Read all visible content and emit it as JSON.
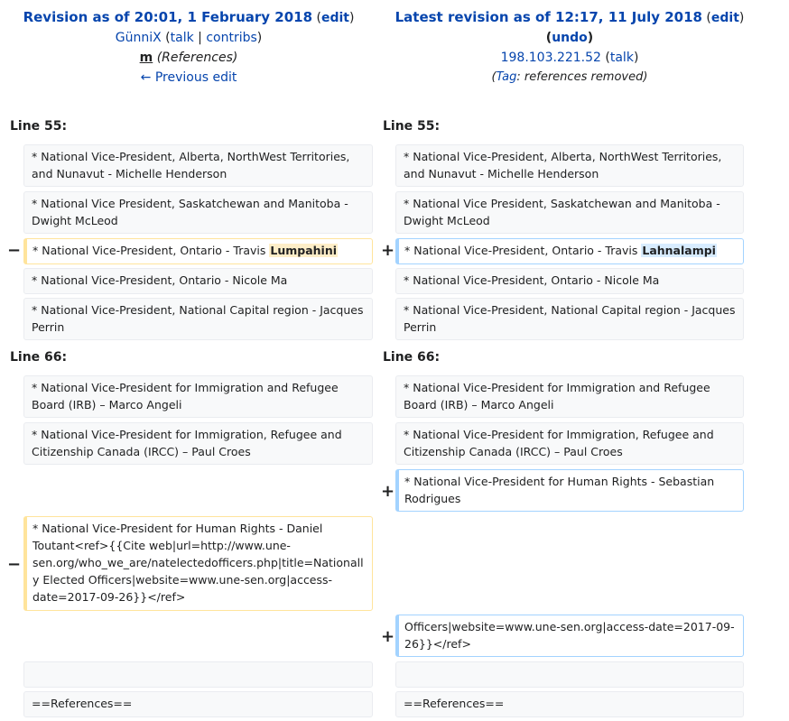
{
  "left_header": {
    "title": "Revision as of 20:01, 1 February 2018",
    "edit": "edit",
    "user": "GünniX",
    "talk": "talk",
    "contribs": "contribs",
    "minor": "m",
    "summary": "(References)",
    "previous": "← Previous edit"
  },
  "right_header": {
    "title": "Latest revision as of 12:17, 11 July 2018",
    "edit": "edit",
    "undo": "undo",
    "user": "198.103.221.52",
    "talk": "talk",
    "tag_label": "Tag",
    "tag_value": ": references removed"
  },
  "markers": {
    "minus": "−",
    "plus": "+"
  },
  "line_labels": {
    "first": "Line 55:",
    "second": "Line 66:"
  },
  "context": {
    "alberta": "* National Vice-President, Alberta, NorthWest Territories, and Nunavut - Michelle Henderson",
    "saskatchewan": "* National Vice President, Saskatchewan and Manitoba - Dwight McLeod",
    "ontario_ma": "* National Vice-President, Ontario - Nicole Ma",
    "ncr": "* National Vice-President, National Capital region - Jacques Perrin",
    "irb": "* National Vice-President for Immigration and Refugee Board (IRB) – Marco Angeli",
    "ircc": "* National Vice-President for Immigration, Refugee and Citizenship Canada (IRCC) – Paul Croes",
    "references": "==References=="
  },
  "changes": {
    "ontario_prefix": "* National Vice-President, Ontario - Travis ",
    "ontario_old_name": "Lumpahini",
    "ontario_new_name": "Lahnalampi",
    "human_rights_added": "* National Vice-President for Human Rights - Sebastian Rodrigues",
    "human_rights_removed": "* National Vice-President for Human Rights - Daniel Toutant<ref>{{Cite web|url=http://www.une-sen.org/who_we_are/natelectedofficers.php|title=Nationally Elected Officers|website=www.une-sen.org|access-date=2017-09-26}}</ref>",
    "officers_added": "Officers|website=www.une-sen.org|access-date=2017-09-26}}</ref>"
  }
}
